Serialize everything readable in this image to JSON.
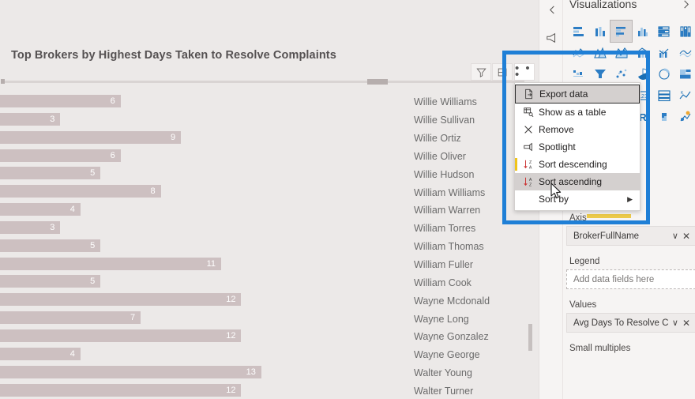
{
  "chart_data": {
    "type": "bar",
    "orientation": "horizontal",
    "title": "Top Brokers by Highest Days Taken to Resolve Complaints",
    "xlabel": "",
    "ylabel": "BrokerFullName",
    "value_field": "Avg Days To Resolve Complaints",
    "grid": false,
    "legend_position": "none",
    "categories": [
      "Willie Williams",
      "Willie Sullivan",
      "Willie Ortiz",
      "Willie Oliver",
      "Willie Hudson",
      "William Williams",
      "William Warren",
      "William Torres",
      "William Thomas",
      "William Fuller",
      "William Cook",
      "Wayne Mcdonald",
      "Wayne Long",
      "Wayne Gonzalez",
      "Wayne George",
      "Walter Young",
      "Walter Turner"
    ],
    "values": [
      6,
      3,
      9,
      6,
      5,
      8,
      4,
      3,
      5,
      11,
      5,
      12,
      7,
      12,
      4,
      13,
      12
    ],
    "xlim": [
      0,
      22
    ],
    "bar_color": "#cdc0c1",
    "label_color": "#ffffff"
  },
  "visual": {
    "title": "Top Brokers by Highest Days Taken to Resolve Complaints",
    "toolbar": {
      "filter_icon": "filter-icon",
      "focus_icon": "focus-mode-icon",
      "more_label": "• • •",
      "more_icon": "more-options-icon"
    },
    "scrollbar": {
      "orientation": "horizontal"
    }
  },
  "context_menu": {
    "items": [
      {
        "label": "Export data",
        "icon": "export-data-icon",
        "state": "selected",
        "submenu": false
      },
      {
        "label": "Show as a table",
        "icon": "show-as-table-icon",
        "state": "normal",
        "submenu": false
      },
      {
        "label": "Remove",
        "icon": "close-x-icon",
        "state": "normal",
        "submenu": false
      },
      {
        "label": "Spotlight",
        "icon": "spotlight-icon",
        "state": "normal",
        "submenu": false
      },
      {
        "label": "Sort descending",
        "icon": "sort-descending-icon",
        "state": "active",
        "submenu": false
      },
      {
        "label": "Sort ascending",
        "icon": "sort-ascending-icon",
        "state": "hover",
        "submenu": false
      },
      {
        "label": "Sort by",
        "icon": "",
        "state": "normal",
        "submenu": true
      }
    ]
  },
  "panel": {
    "title": "Visualizations",
    "collapse_icon": "collapse-chevron-icon",
    "expand_icon": "expand-chevron-icon",
    "speaker_icon": "speaker-icon",
    "gallery": [
      "stacked-bar-chart-icon",
      "stacked-column-chart-icon",
      "clustered-bar-chart-icon",
      "clustered-column-chart-icon",
      "100-stacked-bar-chart-icon",
      "100-stacked-column-chart-icon",
      "line-chart-icon",
      "area-chart-icon",
      "stacked-area-chart-icon",
      "line-stacked-column-chart-icon",
      "line-clustered-column-chart-icon",
      "ribbon-chart-icon",
      "waterfall-chart-icon",
      "funnel-chart-icon",
      "scatter-chart-icon",
      "pie-chart-icon",
      "donut-chart-icon",
      "treemap-icon",
      "map-icon",
      "filled-map-icon",
      "gauge-icon",
      "card-icon",
      "multi-row-card-icon",
      "kpi-icon",
      "slicer-icon",
      "table-icon",
      "matrix-icon",
      "r-script-visual-icon",
      "python-visual-icon",
      "key-influencers-icon",
      "decomposition-tree-icon"
    ],
    "selected_gallery_index": 2,
    "wells": [
      {
        "name": "Axis",
        "value": "BrokerFullName",
        "filled": true,
        "chevron": "chevron-down-icon",
        "remove": "close-x-icon"
      },
      {
        "name": "Legend",
        "value": "Add data fields here",
        "filled": false,
        "chevron": "",
        "remove": ""
      },
      {
        "name": "Values",
        "value": "Avg Days To Resolve Co",
        "filled": true,
        "chevron": "chevron-down-icon",
        "remove": "close-x-icon"
      },
      {
        "name": "Small multiples",
        "value": "",
        "filled": false,
        "chevron": "",
        "remove": ""
      }
    ]
  },
  "annotation": {
    "highlight_color": "#1f7fd6",
    "shape": "rectangle"
  }
}
